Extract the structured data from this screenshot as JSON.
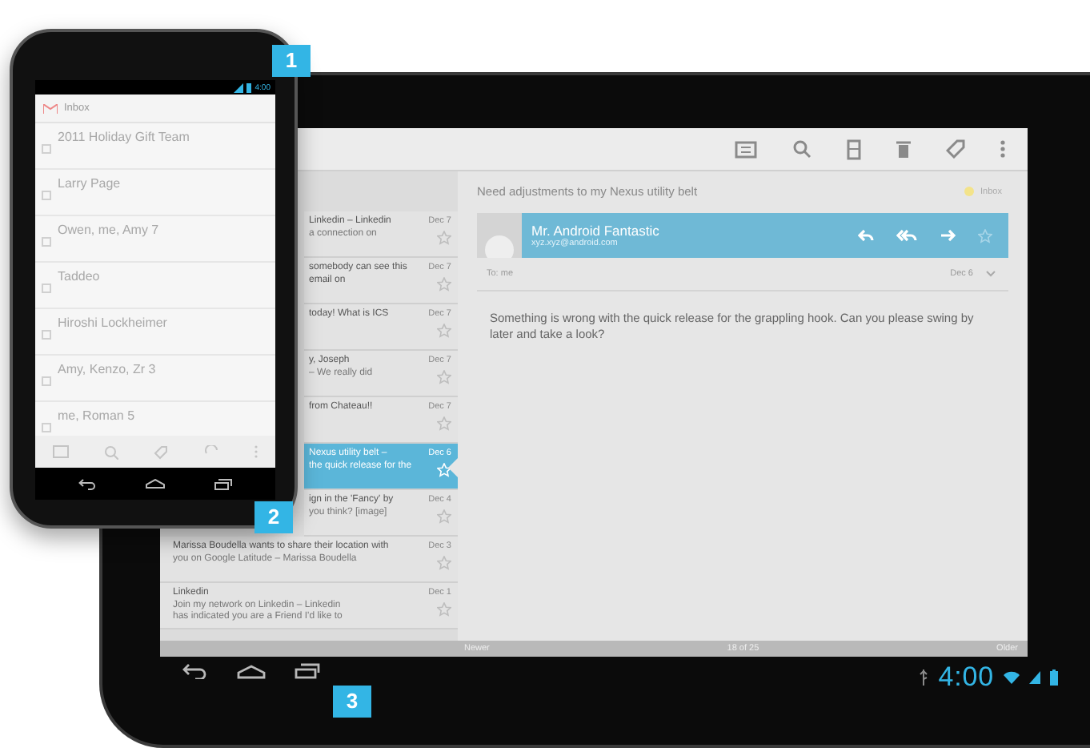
{
  "phone": {
    "status_time": "4:00",
    "inbox_title": "Inbox",
    "threads": [
      {
        "sender": "2011 Holiday Gift Team"
      },
      {
        "sender": "Larry Page"
      },
      {
        "sender": "Owen, me, Amy 7"
      },
      {
        "sender": "Taddeo"
      },
      {
        "sender": "Hiroshi Lockheimer"
      },
      {
        "sender": "Amy, Kenzo, Zr 3"
      },
      {
        "sender": "me, Roman 5"
      }
    ]
  },
  "tablet": {
    "threads": [
      {
        "lines": [
          "Linkedin – Linkedin",
          "a connection on"
        ],
        "date": "Dec 7",
        "selected": false
      },
      {
        "lines": [
          "somebody can see this email on"
        ],
        "date": "Dec 7",
        "selected": false
      },
      {
        "lines": [
          "today! What is ICS"
        ],
        "date": "Dec 7",
        "selected": false
      },
      {
        "lines": [
          "y, Joseph",
          "– We really did"
        ],
        "date": "Dec 7",
        "selected": false
      },
      {
        "lines": [
          "from Chateau!!"
        ],
        "date": "Dec 7",
        "selected": false
      },
      {
        "lines": [
          "Nexus utility belt –",
          "the quick release for the"
        ],
        "date": "Dec 6",
        "selected": true
      },
      {
        "lines": [
          "ign in the 'Fancy' by",
          "you think? [image]"
        ],
        "date": "Dec 4",
        "selected": false
      },
      {
        "lines": [
          "Marissa Boudella wants to share their location with",
          "you on Google Latitude – Marissa Boudella"
        ],
        "date": "Dec 3",
        "selected": false
      },
      {
        "lines": [
          "Linkedin",
          "Join my network on Linkedin – Linkedin",
          "has indicated you are a Friend I'd like to"
        ],
        "date": "Dec 1",
        "selected": false
      }
    ],
    "message": {
      "subject": "Need adjustments to my Nexus utility belt",
      "label": "Inbox",
      "sender_name": "Mr. Android Fantastic",
      "sender_email": "xyz.xyz@android.com",
      "to": "To: me",
      "date": "Dec 6",
      "body": "Something is wrong with the quick release for the grappling hook. Can you please swing by later and take a look?"
    },
    "footer": {
      "newer": "Newer",
      "position": "18 of 25",
      "older": "Older"
    },
    "status_time": "4:00"
  },
  "callouts": [
    "1",
    "2",
    "3"
  ]
}
